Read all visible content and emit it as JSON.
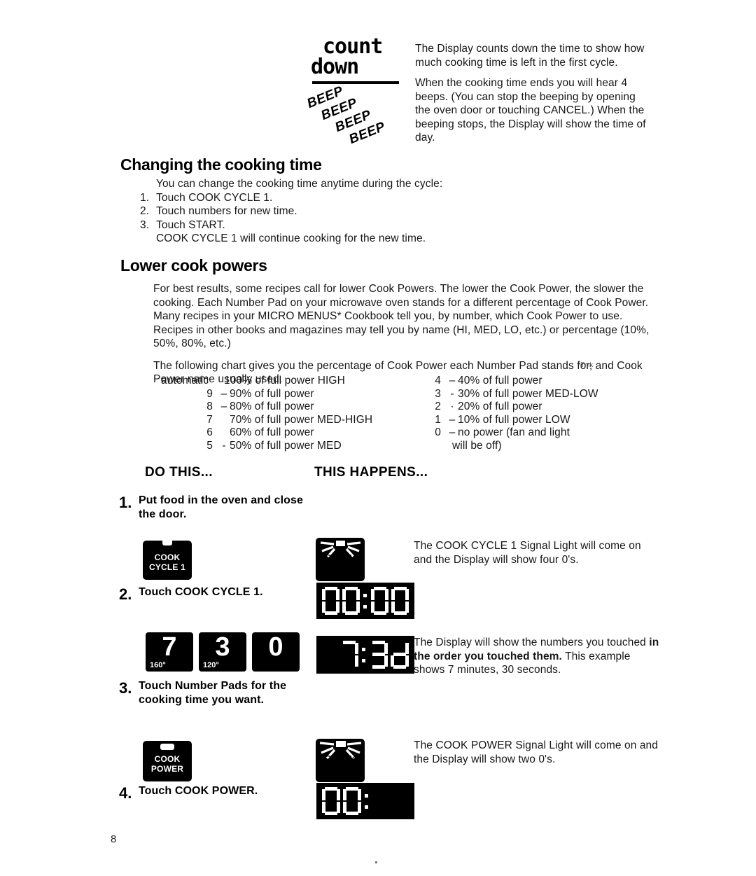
{
  "page": {
    "number": "8",
    "trademark_note": "*Tmk"
  },
  "illustration": {
    "countdown_top": "count",
    "countdown_bottom": "down",
    "beeps": [
      "BEEP",
      "BEEP",
      "BEEP",
      "BEEP"
    ]
  },
  "intro": {
    "paragraph_1": "The Display counts down the time to show how much cooking time is left in the first cycle.",
    "paragraph_2": "When the cooking time ends you will hear 4 beeps. (You can stop the beeping by opening the oven door or touching CANCEL.) When the beeping stops, the Display will show the time of day."
  },
  "changing_cooking_time": {
    "title": "Changing the cooking time",
    "lead": "You can change the cooking time anytime during the cycle:",
    "steps": [
      {
        "n": "1.",
        "text": "Touch COOK CYCLE 1."
      },
      {
        "n": "2.",
        "text": "Touch numbers for new time."
      },
      {
        "n": "3.",
        "text": "Touch START."
      }
    ],
    "closing": "COOK CYCLE 1 will continue cooking for the new time."
  },
  "lower_cook_powers": {
    "title": "Lower cook powers",
    "paragraph_1": "For best results, some recipes call for lower Cook Powers. The lower the Cook Power, the slower the cooking. Each Number Pad on your microwave oven stands for a different percentage of Cook Power. Many recipes in your MICRO MENUS* Cookbook tell you, by number, which Cook Power to use. Recipes in other books and magazines may tell you by name (HI, MED, LO, etc.) or percentage (10%, 50%, 80%, etc.)",
    "paragraph_2": "The following chart gives you the percentage of Cook Power each Number Pad stands for, and Cook Power name usually used."
  },
  "power_chart": {
    "left": [
      {
        "pad": "automatic",
        "dash": "",
        "desc": "100% of full power HIGH"
      },
      {
        "pad": "9",
        "dash": "–",
        "desc": "90% of full power"
      },
      {
        "pad": "8",
        "dash": "–",
        "desc": "80% of full power"
      },
      {
        "pad": "7",
        "dash": "",
        "desc": "70% of full power MED-HIGH"
      },
      {
        "pad": "6",
        "dash": "",
        "desc": "60% of full power"
      },
      {
        "pad": "5",
        "dash": "-",
        "desc": "50% of full power MED"
      }
    ],
    "right": [
      {
        "pad": "4",
        "dash": "–",
        "desc": "40% of full power"
      },
      {
        "pad": "3",
        "dash": "-",
        "desc": "30% of full power MED-LOW"
      },
      {
        "pad": "2",
        "dash": "·",
        "desc": "20% of full power"
      },
      {
        "pad": "1",
        "dash": "–",
        "desc": "10% of full power LOW"
      },
      {
        "pad": "0",
        "dash": "–",
        "desc": "no power (fan and light"
      }
    ],
    "right_continuation": "will be off)"
  },
  "procedure": {
    "col_left_heading": "DO THIS...",
    "col_right_heading": "THIS HAPPENS...",
    "steps": [
      {
        "number": "1.",
        "instruction": "Put food in the oven and close the door.",
        "result": ""
      },
      {
        "number": "2.",
        "instruction": "Touch COOK CYCLE 1.",
        "key_line_1": "COOK",
        "key_line_2": "CYCLE 1",
        "result": "The COOK CYCLE 1 Signal Light will come on and the Display will show four 0's.",
        "display_value": "00:00"
      },
      {
        "number": "3.",
        "instruction": "Touch Number Pads for the cooking time you want.",
        "pads": [
          {
            "digit": "7",
            "sub": "160°"
          },
          {
            "digit": "3",
            "sub": "120°"
          },
          {
            "digit": "0",
            "sub": ""
          }
        ],
        "result_part_1": "The Display will show the numbers you touched ",
        "result_bold": "in the order you touched them.",
        "result_part_2": " This example shows 7 minutes, 30 seconds.",
        "display_value": "7:30"
      },
      {
        "number": "4.",
        "instruction": "Touch COOK POWER.",
        "key_line_1": "COOK",
        "key_line_2": "POWER",
        "result": "The COOK POWER Signal Light will come on and the Display will show two 0's.",
        "display_value": "00:"
      }
    ]
  },
  "icons": {
    "key_notch": "key-notch",
    "signal_rays": "signal-light-rays"
  }
}
